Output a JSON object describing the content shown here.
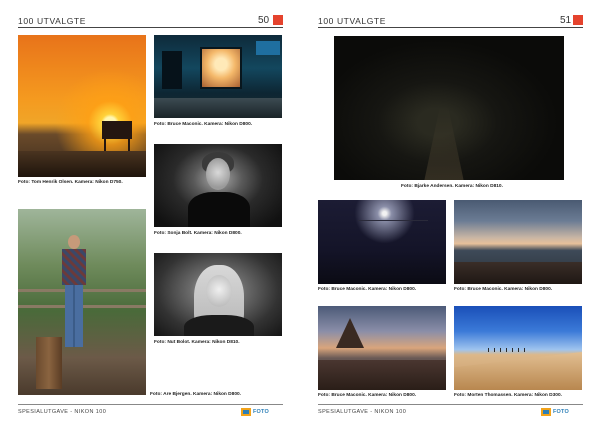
{
  "left_page": {
    "header_title": "100 UTVALGTE",
    "page_number": "50",
    "footer_text": "SPESIALUTGAVE - NIKON 100",
    "footer_logo": "FOTO",
    "captions": [
      "Foto: Tom Henrik Olsen. Kamera: Nikon D750.",
      "Foto: Bruce Maconic. Kamera: Nikon D800.",
      "Foto: Sonja Bolt. Kamera: Nikon D800.",
      "Foto: Nut Bolot. Kamera: Nikon D810.",
      "Foto: Are Bjergen. Kamera: Nikon D800."
    ]
  },
  "right_page": {
    "header_title": "100 UTVALGTE",
    "page_number": "51",
    "footer_text": "SPESIALUTGAVE - NIKON 100",
    "footer_logo": "FOTO",
    "captions": [
      "Foto: Bjarke Andersen. Kamera: Nikon D810.",
      "Foto: Bruce Maconic. Kamera: Nikon D800.",
      "Foto: Bruce Maconic. Kamera: Nikon D800.",
      "Foto: Bruce Maconic. Kamera: Nikon D800.",
      "Foto: Morten Thomassen. Kamera: Nikon D300."
    ]
  },
  "colors": {
    "accent": "#e5432d",
    "logo_blue": "#2c7fb8",
    "logo_orange": "#f2a31a"
  }
}
